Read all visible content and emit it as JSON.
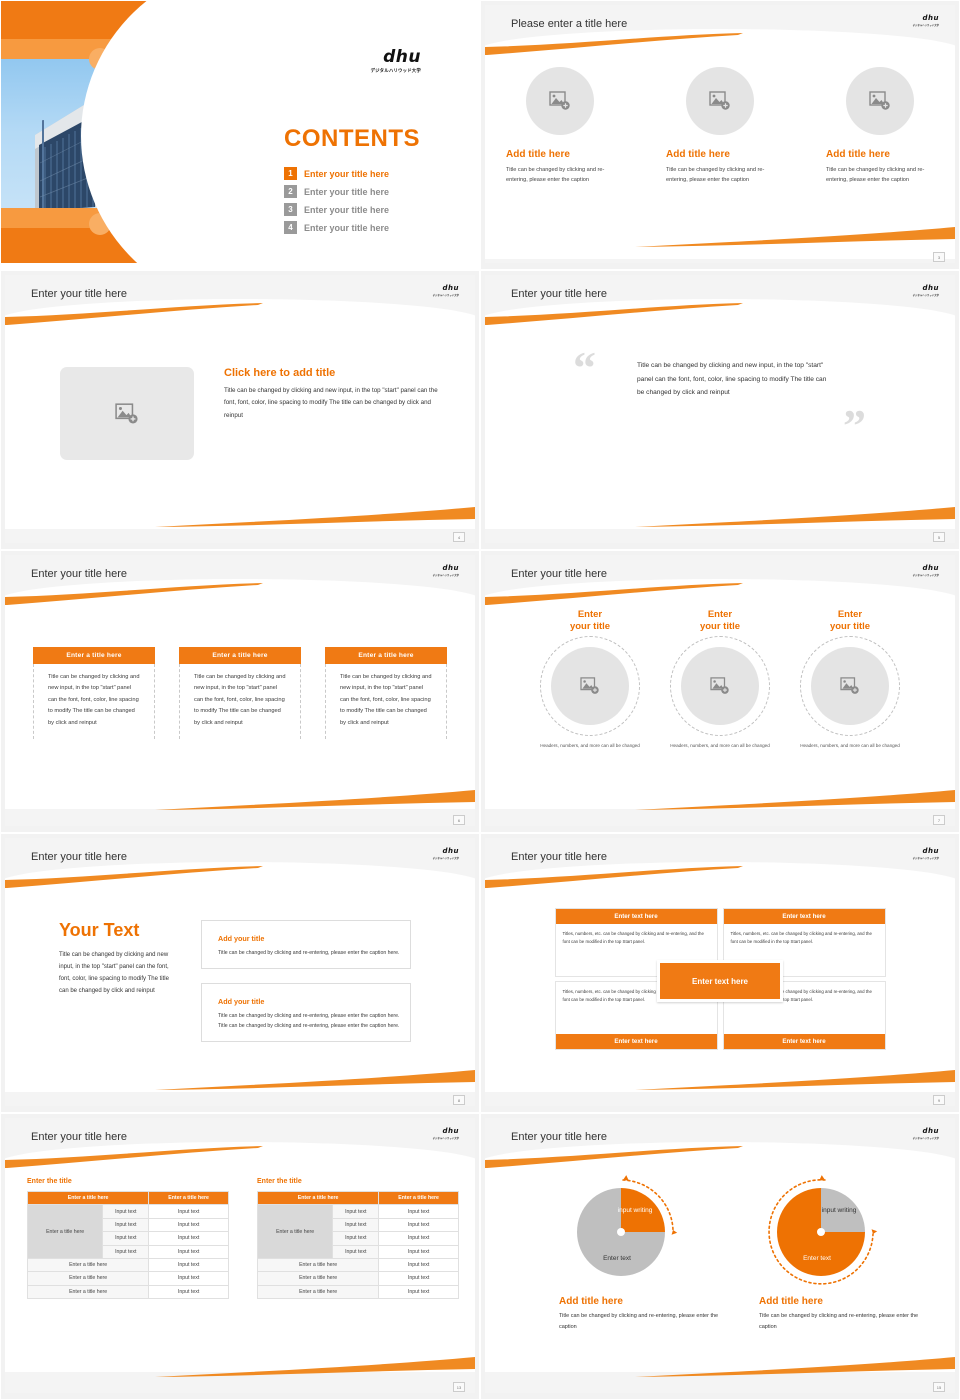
{
  "brand": {
    "accent": "#EE7203",
    "accent_bar": "#F07A14",
    "logo_main": "dhu",
    "logo_sub": "デジタルハリウッド大学"
  },
  "slide1": {
    "heading": "CONTENTS",
    "toc": [
      {
        "num": "1",
        "label": "Enter your title here",
        "active": true
      },
      {
        "num": "2",
        "label": "Enter your title here",
        "active": false
      },
      {
        "num": "3",
        "label": "Enter your title here",
        "active": false
      },
      {
        "num": "4",
        "label": "Enter your title here",
        "active": false
      }
    ]
  },
  "slide2": {
    "title": "Please enter a title here",
    "page": "3",
    "cards": [
      {
        "title": "Add title here",
        "body": "Title can be changed by clicking and re-entering, please enter the caption"
      },
      {
        "title": "Add title here",
        "body": "Title can be changed by clicking and re-entering, please enter the caption"
      },
      {
        "title": "Add title here",
        "body": "Title can be changed by clicking and re-entering, please enter the caption"
      }
    ]
  },
  "slide3": {
    "title": "Enter your title here",
    "page": "4",
    "headline": "Click here to add title",
    "body": "Title can be changed by clicking and new input, in the top \"start\" panel can the font, font, color, line spacing to modify The title can be changed by click and reinput"
  },
  "slide4": {
    "title": "Enter your title here",
    "page": "5",
    "quote_open": "“",
    "quote_close": "”",
    "quote": "Title can be changed by clicking and new input, in the top \"start\" panel can the font, font, color, line spacing to modify The title can be changed by click and reinput"
  },
  "slide5": {
    "title": "Enter your title here",
    "page": "6",
    "columns": [
      {
        "header": "Enter a title here",
        "body": "Title can be changed by clicking and new input, in the top \"start\" panel can the font, font, color, line spacing to modify The title can be changed by click and reinput"
      },
      {
        "header": "Enter a title here",
        "body": "Title can be changed by clicking and new input, in the top \"start\" panel can the font, font, color, line spacing to modify The title can be changed by click and reinput"
      },
      {
        "header": "Enter a title here",
        "body": "Title can be changed by clicking and new input, in the top \"start\" panel can the font, font, color, line spacing to modify The title can be changed by click and reinput"
      }
    ]
  },
  "slide6": {
    "title": "Enter your title here",
    "page": "7",
    "rings": [
      {
        "title": "Enter\nyour title",
        "caption": "Headers, numbers, and more can all be changed"
      },
      {
        "title": "Enter\nyour title",
        "caption": "Headers, numbers, and more can all be changed"
      },
      {
        "title": "Enter\nyour title",
        "caption": "Headers, numbers, and more can all be changed"
      }
    ]
  },
  "slide7": {
    "title": "Enter your title here",
    "page": "8",
    "big_text": "Your Text",
    "big_body": "Title can be changed by clicking and new input, in the top \"start\" panel can the font, font, color, line spacing to modify The title can be changed by click and reinput",
    "cards": [
      {
        "title": "Add your title",
        "body": "Title can be changed by clicking and re-entering, please enter the caption here."
      },
      {
        "title": "Add your title",
        "body": "Title can be changed by clicking and re-entering, please enter the caption here. Title can be changed by clicking and re-entering, please enter the caption here."
      }
    ]
  },
  "slide8": {
    "title": "Enter your title here",
    "page": "9",
    "center_label": "Enter text here",
    "body_text": "Titles, numbers, etc. can be changed by clicking and re-entering, and the font can be modified in the top Start panel.",
    "boxes": [
      {
        "header": "Enter text here",
        "pos": "top"
      },
      {
        "header": "Enter text here",
        "pos": "top"
      },
      {
        "header": "Enter text here",
        "pos": "bottom"
      },
      {
        "header": "Enter text here",
        "pos": "bottom"
      }
    ]
  },
  "slide9": {
    "title": "Enter your title here",
    "page": "13",
    "tables": [
      {
        "caption": "Enter the title",
        "headers": [
          "Enter a title here",
          "Enter a title here"
        ],
        "rowhead": "Enter a title here",
        "merged_rows": [
          [
            "Input text",
            "Input text"
          ],
          [
            "Input text",
            "Input text"
          ],
          [
            "Input text",
            "Input text"
          ],
          [
            "Input text",
            "Input text"
          ]
        ],
        "footer_rows": [
          [
            "Enter a title here",
            "Input text"
          ],
          [
            "Enter a title here",
            "Input text"
          ],
          [
            "Enter a title here",
            "Input text"
          ]
        ]
      },
      {
        "caption": "Enter the title",
        "headers": [
          "Enter a title here",
          "Enter a title here"
        ],
        "rowhead": "Enter a title here",
        "merged_rows": [
          [
            "Input text",
            "Input text"
          ],
          [
            "Input text",
            "Input text"
          ],
          [
            "Input text",
            "Input text"
          ],
          [
            "Input text",
            "Input text"
          ]
        ],
        "footer_rows": [
          [
            "Enter a title here",
            "Input text"
          ],
          [
            "Enter a title here",
            "Input text"
          ],
          [
            "Enter a title here",
            "Input text"
          ]
        ]
      }
    ]
  },
  "slide10": {
    "title": "Enter your title here",
    "page": "15",
    "charts": [
      {
        "slice_label": "input writing",
        "rest_label": "Enter text",
        "title": "Add title here",
        "caption": "Title can be changed by clicking and re-entering, please enter the caption"
      },
      {
        "slice_label": "input writing",
        "rest_label": "Enter text",
        "title": "Add title here",
        "caption": "Title can be changed by clicking and re-entering, please enter the caption"
      }
    ]
  },
  "chart_data": [
    {
      "type": "pie",
      "title": "Add title here",
      "categories": [
        "input writing",
        "Enter text"
      ],
      "values": [
        25,
        75
      ],
      "colors": [
        "#EE7203",
        "#BFBFBF"
      ],
      "legend": "none"
    },
    {
      "type": "pie",
      "title": "Add title here",
      "categories": [
        "Enter text",
        "input writing"
      ],
      "values": [
        75,
        25
      ],
      "colors": [
        "#EE7203",
        "#BFBFBF"
      ],
      "legend": "none"
    }
  ]
}
